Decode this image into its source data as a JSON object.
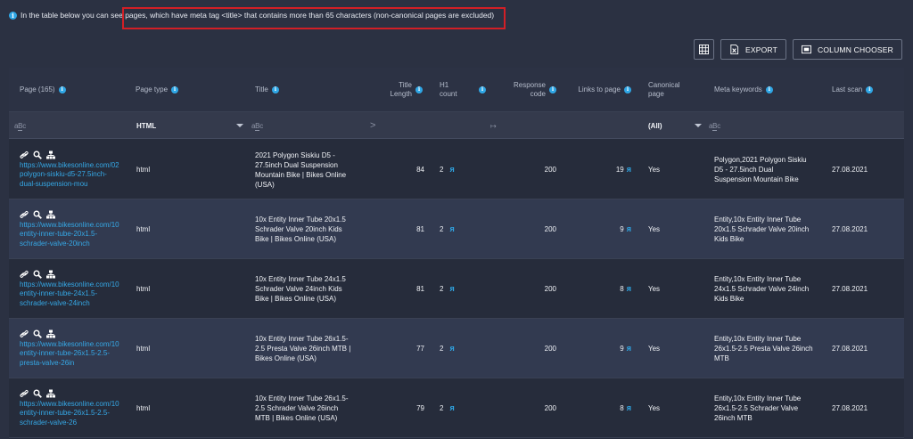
{
  "info": {
    "text": "In the table below you can see pages, which have meta tag <title> that contains more than 65 characters (non-canonical pages are excluded)"
  },
  "toolbar": {
    "export_label": "EXPORT",
    "column_chooser_label": "COLUMN CHOOSER"
  },
  "columns": {
    "page": "Page (165)",
    "page_type": "Page type",
    "title": "Title",
    "title_length": "Title\nLength",
    "h1_count": "H1\ncount",
    "response_code": "Response\ncode",
    "links_to_page": "Links to page",
    "canonical_page": "Canonical\npage",
    "meta_keywords": "Meta keywords",
    "last_scan": "Last scan"
  },
  "filters": {
    "page_type": "HTML",
    "canonical": "(All)",
    "title_length_op": ">",
    "response_code_op": "↦"
  },
  "rows": [
    {
      "url": "https://www.bikesonline.com/02\npolygon-siskiu-d5-27.5inch-\ndual-suspension-mou",
      "page_type": "html",
      "title": "2021 Polygon Siskiu D5 -\n27.5inch Dual Suspension\nMountain Bike | Bikes Online\n(USA)",
      "title_length": "84",
      "h1_count": "2",
      "response_code": "200",
      "links_to_page": "19",
      "canonical": "Yes",
      "meta_keywords": "Polygon,2021 Polygon Siskiu\nD5 - 27.5inch Dual\nSuspension Mountain Bike",
      "last_scan": "27.08.2021"
    },
    {
      "url": "https://www.bikesonline.com/10\nentity-inner-tube-20x1.5-\nschrader-valve-20inch",
      "page_type": "html",
      "title": "10x Entity Inner Tube 20x1.5\nSchrader Valve 20inch Kids\nBike | Bikes Online (USA)",
      "title_length": "81",
      "h1_count": "2",
      "response_code": "200",
      "links_to_page": "9",
      "canonical": "Yes",
      "meta_keywords": "Entity,10x Entity Inner Tube\n20x1.5 Schrader Valve 20inch\nKids Bike",
      "last_scan": "27.08.2021"
    },
    {
      "url": "https://www.bikesonline.com/10\nentity-inner-tube-24x1.5-\nschrader-valve-24inch",
      "page_type": "html",
      "title": "10x Entity Inner Tube 24x1.5\nSchrader Valve 24inch Kids\nBike | Bikes Online (USA)",
      "title_length": "81",
      "h1_count": "2",
      "response_code": "200",
      "links_to_page": "8",
      "canonical": "Yes",
      "meta_keywords": "Entity,10x Entity Inner Tube\n24x1.5 Schrader Valve 24inch\nKids Bike",
      "last_scan": "27.08.2021"
    },
    {
      "url": "https://www.bikesonline.com/10\nentity-inner-tube-26x1.5-2.5-\npresta-valve-26in",
      "page_type": "html",
      "title": "10x Entity Inner Tube 26x1.5-\n2.5 Presta Valve 26inch MTB |\nBikes Online (USA)",
      "title_length": "77",
      "h1_count": "2",
      "response_code": "200",
      "links_to_page": "9",
      "canonical": "Yes",
      "meta_keywords": "Entity,10x Entity Inner Tube\n26x1.5-2.5 Presta Valve 26inch\nMTB",
      "last_scan": "27.08.2021"
    },
    {
      "url": "https://www.bikesonline.com/10\nentity-inner-tube-26x1.5-2.5-\nschrader-valve-26",
      "page_type": "html",
      "title": "10x Entity Inner Tube 26x1.5-\n2.5 Schrader Valve 26inch\nMTB | Bikes Online (USA)",
      "title_length": "79",
      "h1_count": "2",
      "response_code": "200",
      "links_to_page": "8",
      "canonical": "Yes",
      "meta_keywords": "Entity,10x Entity Inner Tube\n26x1.5-2.5 Schrader Valve\n26inch MTB",
      "last_scan": "27.08.2021"
    }
  ]
}
